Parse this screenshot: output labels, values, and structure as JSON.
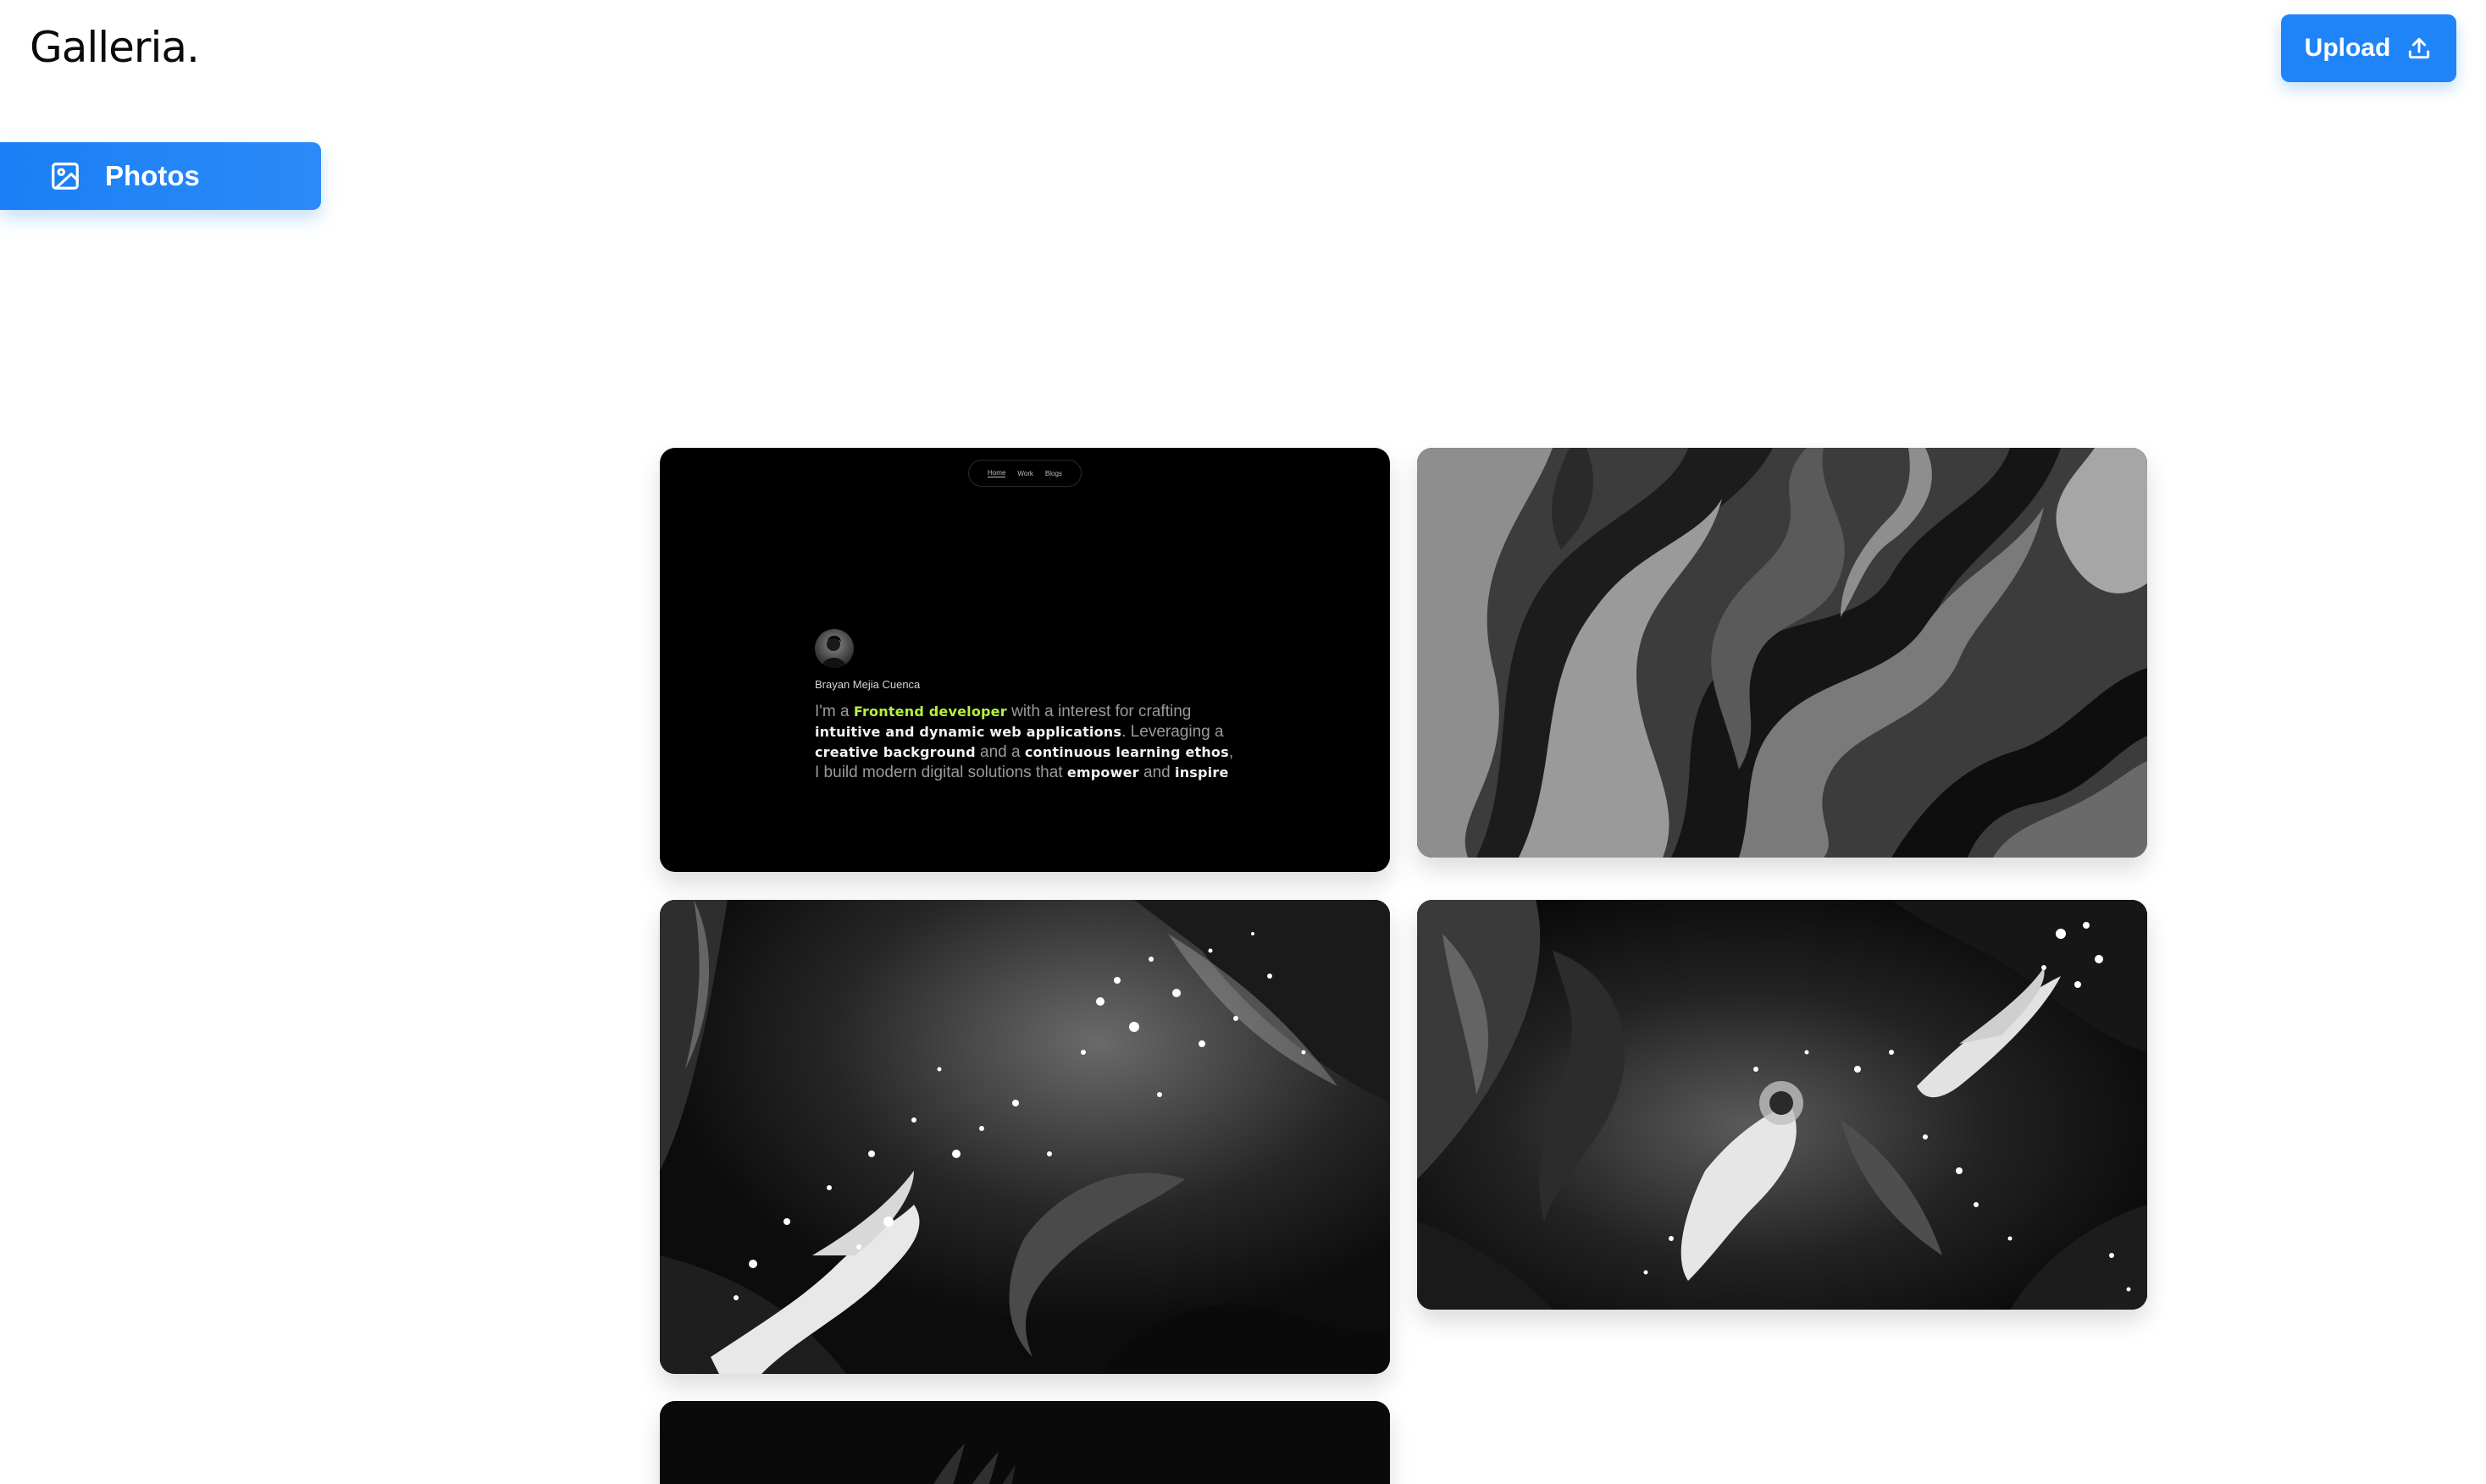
{
  "app": {
    "logo": "Galleria."
  },
  "header": {
    "upload_label": "Upload",
    "upload_icon": "upload-icon"
  },
  "sidebar": {
    "items": [
      {
        "label": "Photos",
        "icon": "image-icon",
        "active": true
      }
    ]
  },
  "colors": {
    "accent": "#1f84f8",
    "highlight_green": "#b6f23d"
  },
  "gallery": {
    "photos": [
      {
        "kind": "website-screenshot",
        "nav": [
          "Home",
          "Work",
          "Blogs"
        ],
        "name": "Brayan Mejia Cuenca",
        "bio": {
          "p1": "I'm a ",
          "h1": "Frontend developer",
          "p2": " with a interest for crafting ",
          "h2": "intuitive and dynamic web applications",
          "p3": ". Leveraging a ",
          "h3": "creative background",
          "p4": " and a ",
          "h4": "continuous learning ethos",
          "p5": ", I build modern digital solutions that ",
          "h5": "empower",
          "p6": " and ",
          "h6": "inspire"
        }
      },
      {
        "kind": "abstract-marble-flow"
      },
      {
        "kind": "abstract-ink-splash"
      },
      {
        "kind": "abstract-ink-splash"
      },
      {
        "kind": "abstract-dark"
      }
    ]
  }
}
